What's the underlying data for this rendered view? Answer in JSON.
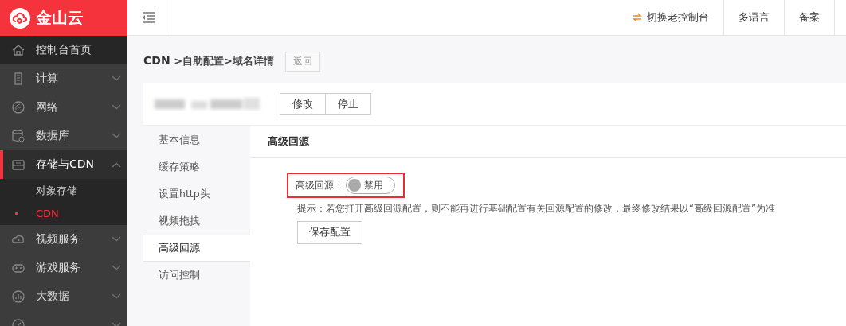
{
  "logo": {
    "text": "金山云"
  },
  "topbar": {
    "switch_link": "切换老控制台",
    "links": [
      "多语言",
      "备案"
    ]
  },
  "sidebar": {
    "items": [
      {
        "label": "控制台首页",
        "kind": "home",
        "active": false
      },
      {
        "label": "计算",
        "kind": "group",
        "active": false,
        "expanded": false
      },
      {
        "label": "网络",
        "kind": "group",
        "active": false,
        "expanded": false
      },
      {
        "label": "数据库",
        "kind": "group",
        "active": false,
        "expanded": false
      },
      {
        "label": "存储与CDN",
        "kind": "group",
        "active": true,
        "expanded": true,
        "children": [
          {
            "label": "对象存储",
            "selected": false
          },
          {
            "label": "CDN",
            "selected": true
          }
        ]
      },
      {
        "label": "视频服务",
        "kind": "group",
        "active": false,
        "expanded": false
      },
      {
        "label": "游戏服务",
        "kind": "group",
        "active": false,
        "expanded": false
      },
      {
        "label": "大数据",
        "kind": "group",
        "active": false,
        "expanded": false
      },
      {
        "kind": "group",
        "active": false,
        "expanded": false
      }
    ]
  },
  "breadcrumb": {
    "root": "CDN",
    "path": " >自助配置>域名详情",
    "back_button": "返回"
  },
  "domain": {
    "actions": [
      "修改",
      "停止"
    ]
  },
  "tabs": [
    {
      "label": "基本信息",
      "selected": false
    },
    {
      "label": "缓存策略",
      "selected": false
    },
    {
      "label": "设置http头",
      "selected": false
    },
    {
      "label": "视频拖拽",
      "selected": false
    },
    {
      "label": "高级回源",
      "selected": true
    },
    {
      "label": "访问控制",
      "selected": false
    }
  ],
  "panel": {
    "title": "高级回源",
    "switch": {
      "label": "高级回源：",
      "on": false,
      "text": "禁用",
      "highlighted": true
    },
    "hint": "提示：若您打开高级回源配置，则不能再进行基础配置有关回源配置的修改，最终修改结果以“高级回源配置”为准",
    "save_button": "保存配置"
  }
}
